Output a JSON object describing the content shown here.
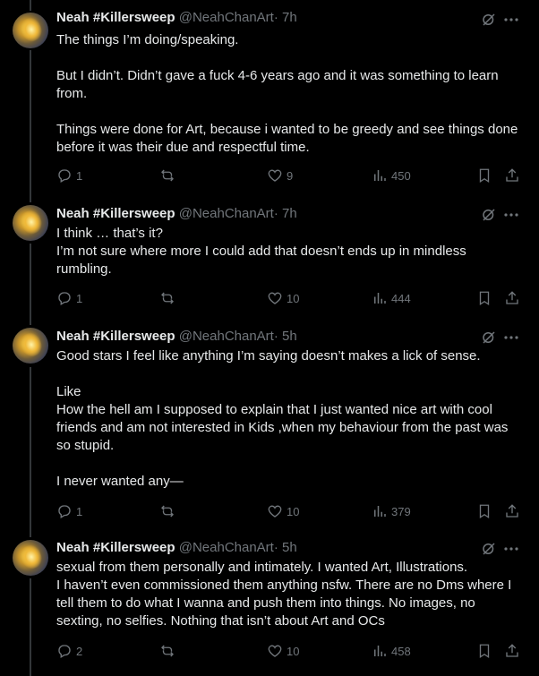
{
  "tweets": [
    {
      "author": "Neah #Killersweep",
      "handle": "@NeahChanArt",
      "separator": "·",
      "time": "7h",
      "paragraphs": [
        "The things I’m doing/speaking.",
        "But I didn’t. Didn’t gave a fuck 4-6 years ago and it was something to learn from.",
        "Things were done for Art, because i wanted to be greedy and see things done before it was their due and respectful time."
      ],
      "replies": "1",
      "retweets": "",
      "likes": "9",
      "views": "450"
    },
    {
      "author": "Neah #Killersweep",
      "handle": "@NeahChanArt",
      "separator": "·",
      "time": "7h",
      "paragraphs": [
        "I think … that’s it?\nI’m not sure where more I could add that doesn’t ends up in mindless rumbling."
      ],
      "replies": "1",
      "retweets": "",
      "likes": "10",
      "views": "444"
    },
    {
      "author": "Neah #Killersweep",
      "handle": "@NeahChanArt",
      "separator": "·",
      "time": "5h",
      "paragraphs": [
        "Good stars I feel like anything I’m saying doesn’t makes a lick of sense.",
        "Like\nHow the hell am I supposed to explain that I just wanted nice art with cool friends and am not interested in Kids ,when my behaviour from the past was so stupid.",
        "I never wanted any—"
      ],
      "replies": "1",
      "retweets": "",
      "likes": "10",
      "views": "379"
    },
    {
      "author": "Neah #Killersweep",
      "handle": "@NeahChanArt",
      "separator": "·",
      "time": "5h",
      "paragraphs": [
        "sexual from them personally and intimately. I wanted Art, Illustrations.\nI haven’t even commissioned them anything nsfw. There are no Dms where I tell them to do what I wanna and push them into things. No images, no sexting, no selfies. Nothing that isn’t about Art and OCs"
      ],
      "replies": "2",
      "retweets": "",
      "likes": "10",
      "views": "458"
    }
  ],
  "icons": {
    "reply": "reply-icon",
    "retweet": "retweet-icon",
    "like": "heart-icon",
    "views": "views-icon",
    "bookmark": "bookmark-icon",
    "share": "share-icon",
    "more": "more-icon",
    "grok": "grok-icon"
  },
  "colors": {
    "background": "#000000",
    "text": "#e7e9ea",
    "secondary": "#71767b",
    "thread_line": "#333639"
  }
}
